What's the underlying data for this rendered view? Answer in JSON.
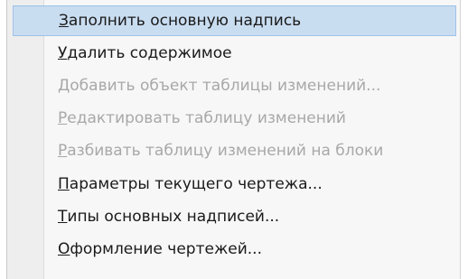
{
  "menu": {
    "items": [
      {
        "label": "Заполнить основную надпись",
        "enabled": true,
        "highlighted": true
      },
      {
        "label": "Удалить содержимое",
        "enabled": true,
        "highlighted": false
      },
      {
        "label": "Добавить объект таблицы изменений...",
        "enabled": false,
        "highlighted": false
      },
      {
        "label": "Редактировать таблицу изменений",
        "enabled": false,
        "highlighted": false
      },
      {
        "label": "Разбивать таблицу изменений на блоки",
        "enabled": false,
        "highlighted": false
      },
      {
        "label": "Параметры текущего чертежа...",
        "enabled": true,
        "highlighted": false
      },
      {
        "label": "Типы основных надписей...",
        "enabled": true,
        "highlighted": false
      },
      {
        "label": "Оформление чертежей...",
        "enabled": true,
        "highlighted": false
      }
    ]
  },
  "colors": {
    "highlight_bg": "#c9ddf1",
    "highlight_border": "#9ec1e6",
    "disabled_text": "#a8a8a8",
    "text": "#1a1a1a"
  }
}
